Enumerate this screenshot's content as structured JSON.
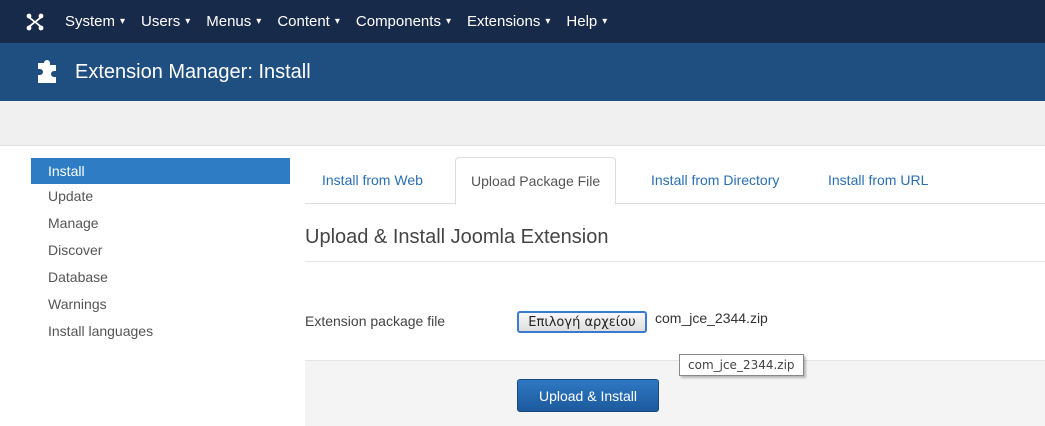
{
  "topnav": {
    "logo_icon": "joomla-logo-icon",
    "items": [
      {
        "label": "System"
      },
      {
        "label": "Users"
      },
      {
        "label": "Menus"
      },
      {
        "label": "Content"
      },
      {
        "label": "Components"
      },
      {
        "label": "Extensions"
      },
      {
        "label": "Help"
      }
    ]
  },
  "titlebar": {
    "icon": "puzzle-icon",
    "title": "Extension Manager: Install"
  },
  "sidebar": {
    "items": [
      {
        "label": "Install",
        "active": true
      },
      {
        "label": "Update"
      },
      {
        "label": "Manage"
      },
      {
        "label": "Discover"
      },
      {
        "label": "Database"
      },
      {
        "label": "Warnings"
      },
      {
        "label": "Install languages"
      }
    ]
  },
  "tabs": [
    {
      "label": "Install from Web"
    },
    {
      "label": "Upload Package File",
      "active": true
    },
    {
      "label": "Install from Directory"
    },
    {
      "label": "Install from URL"
    }
  ],
  "main": {
    "section_title": "Upload & Install Joomla Extension",
    "package_label": "Extension package file",
    "choose_file_label": "Επιλογή αρχείου",
    "file_name": "com_jce_2344.zip",
    "tooltip": "com_jce_2344.zip",
    "upload_button": "Upload & Install"
  },
  "colors": {
    "topnav_bg": "#182a4a",
    "titlebar_bg": "#1f4f80",
    "active_side": "#2d7cc4",
    "link": "#2a6fb2",
    "primary_button": "#2e79c4"
  }
}
